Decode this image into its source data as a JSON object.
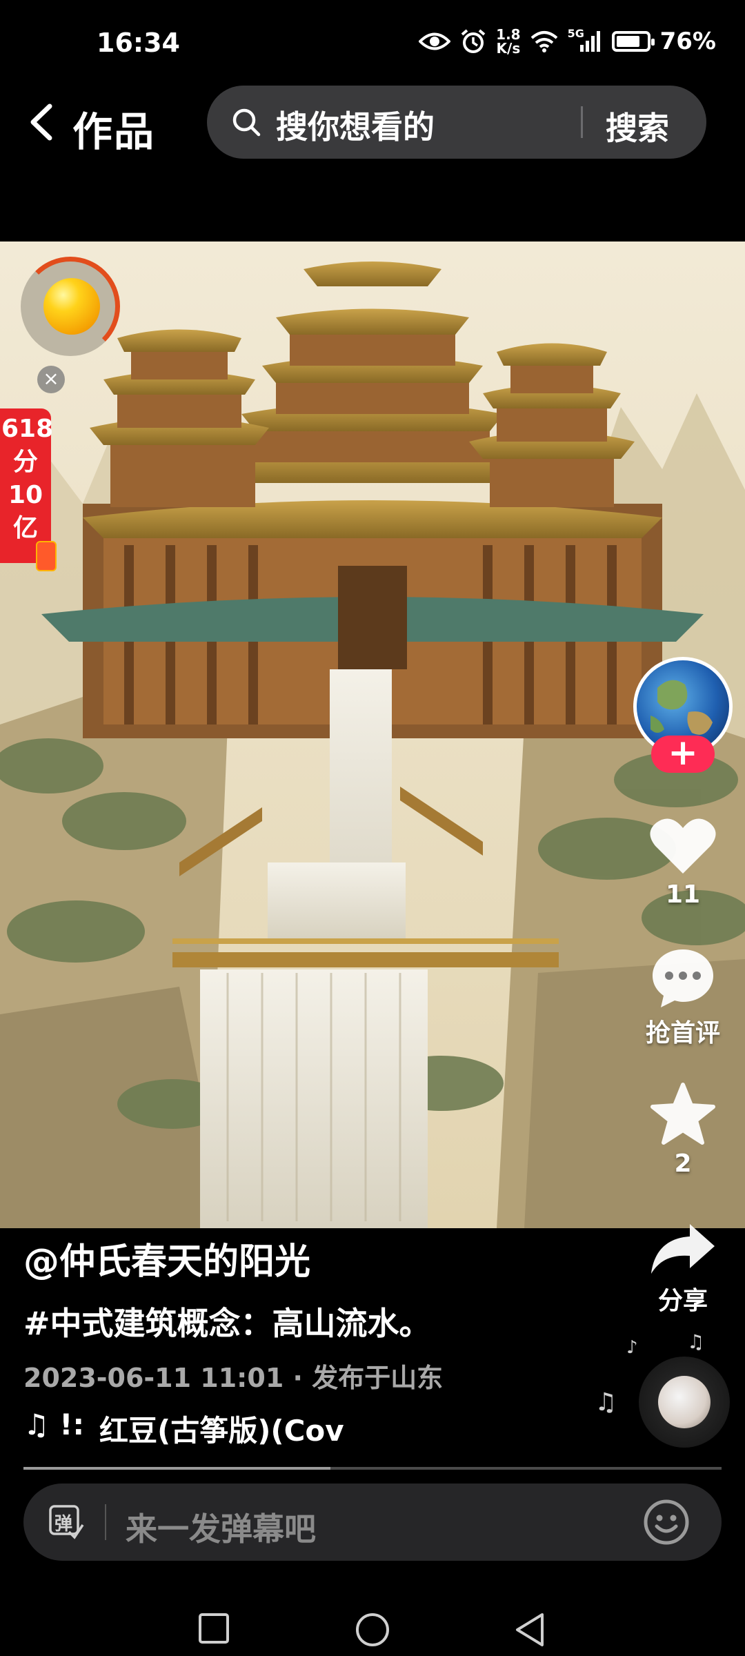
{
  "status_bar": {
    "time": "16:34",
    "net_speed_value": "1.8",
    "net_speed_unit": "K/s",
    "signal_label": "5G",
    "battery_percent": "76%",
    "battery_level": 0.76
  },
  "header": {
    "back_icon": "chevron-left-icon",
    "title": "作品",
    "search_placeholder": "搜你想看的",
    "search_button": "搜索"
  },
  "promo": {
    "badge_lines": [
      "618",
      "分",
      "10",
      "亿"
    ],
    "close_label": "×"
  },
  "creator": {
    "follow_label": "+"
  },
  "actions": {
    "like_count": "11",
    "comment_label": "抢首评",
    "favorite_count": "2",
    "share_label": "分享"
  },
  "caption": {
    "author": "@仲氏春天的阳光",
    "description": "#中式建筑概念：高山流水。",
    "meta": "2023-06-11 11:01 · 发布于山东",
    "music_prefix": "♫ !:",
    "music_title": "红豆(古筝版)(Cov"
  },
  "playback": {
    "progress": 0.44
  },
  "danmaku": {
    "toggle_label": "弹",
    "placeholder": "来一发弹幕吧"
  },
  "colors": {
    "accent": "#fe2c55",
    "promo_red": "#e8242a",
    "background": "#000000"
  }
}
